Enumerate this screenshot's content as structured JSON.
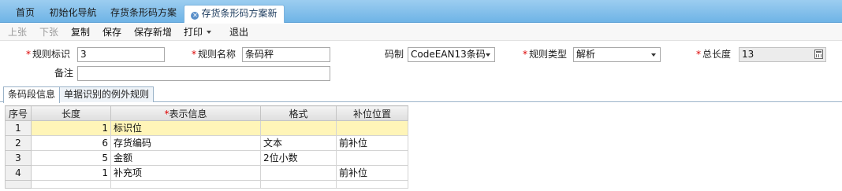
{
  "tabs": [
    {
      "label": "首页",
      "active": false
    },
    {
      "label": "初始化导航",
      "active": false
    },
    {
      "label": "存货条形码方案",
      "active": false
    },
    {
      "label": "存货条形码方案新增",
      "active": true
    }
  ],
  "toolbar": {
    "prev": "上张",
    "next": "下张",
    "copy": "复制",
    "save": "保存",
    "save_new": "保存新增",
    "print": "打印",
    "exit": "退出"
  },
  "form": {
    "rule_id_label": "规则标识",
    "rule_id_value": "3",
    "rule_name_label": "规则名称",
    "rule_name_value": "条码秤",
    "code_system_label": "码制",
    "code_system_value": "CodeEAN13条码",
    "rule_type_label": "规则类型",
    "rule_type_value": "解析",
    "total_length_label": "总长度",
    "total_length_value": "13",
    "remark_label": "备注",
    "remark_value": ""
  },
  "subtabs": {
    "segment_info": "条码段信息",
    "exception_rules": "单据识别的例外规则"
  },
  "grid": {
    "headers": {
      "seq": "序号",
      "length": "长度",
      "display": "表示信息",
      "format": "格式",
      "pad_position": "补位位置"
    },
    "rows": [
      {
        "seq": "1",
        "length": "1",
        "display": "标识位",
        "format": "",
        "pad_position": ""
      },
      {
        "seq": "2",
        "length": "6",
        "display": "存货编码",
        "format": "文本",
        "pad_position": "前补位"
      },
      {
        "seq": "3",
        "length": "5",
        "display": "金额",
        "format": "2位小数",
        "pad_position": ""
      },
      {
        "seq": "4",
        "length": "1",
        "display": "补充项",
        "format": "",
        "pad_position": "前补位"
      }
    ]
  }
}
